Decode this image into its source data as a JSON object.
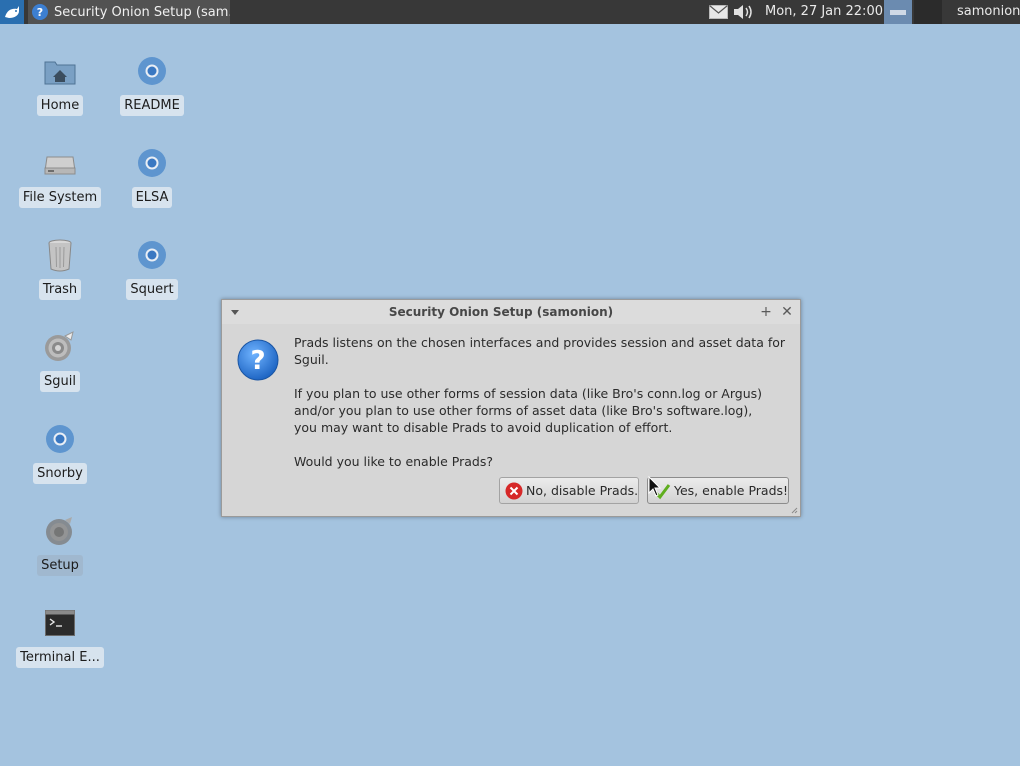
{
  "panel": {
    "task_title": "Security Onion Setup (sam...",
    "clock": "Mon, 27 Jan  22:00",
    "user": "samonion"
  },
  "desktop": {
    "icons": [
      {
        "label": "Home",
        "icon": "home-folder-icon"
      },
      {
        "label": "README",
        "icon": "chromium-icon"
      },
      {
        "label": "File System",
        "icon": "drive-icon"
      },
      {
        "label": "ELSA",
        "icon": "chromium-icon"
      },
      {
        "label": "Trash",
        "icon": "trash-icon"
      },
      {
        "label": "Squert",
        "icon": "chromium-icon"
      },
      {
        "label": "Sguil",
        "icon": "sguil-icon"
      },
      {
        "label": "Snorby",
        "icon": "chromium-icon"
      },
      {
        "label": "Setup",
        "icon": "onion-icon"
      },
      {
        "label": "Terminal E...",
        "icon": "terminal-icon"
      }
    ]
  },
  "dialog": {
    "title": "Security Onion Setup (samonion)",
    "line1": "Prads listens on the chosen interfaces and provides session and asset data for Sguil.",
    "line2": "If you plan to use other forms of session data (like Bro's conn.log or Argus)",
    "line3": "and/or you plan to use other forms of asset data (like Bro's software.log),",
    "line4": "you may want to disable Prads to avoid duplication of effort.",
    "line5": "Would you like to enable Prads?",
    "no_label": "No, disable Prads.",
    "yes_label": "Yes, enable Prads!"
  }
}
